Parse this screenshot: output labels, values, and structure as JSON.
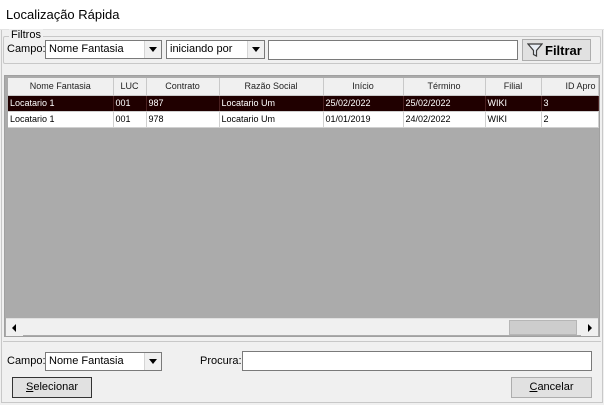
{
  "window": {
    "title": "Localização Rápida"
  },
  "filters": {
    "legend": "Filtros",
    "field_label": "Campo:",
    "field_value": "Nome Fantasia",
    "mode_value": "iniciando por",
    "search_value": "",
    "filter_button": "Filtrar"
  },
  "grid": {
    "columns": [
      "Nome Fantasia",
      "LUC",
      "Contrato",
      "Razão Social",
      "Início",
      "Término",
      "Filial",
      "ID Apro"
    ],
    "rows": [
      {
        "selected": true,
        "cells": [
          "Locatario 1",
          "001",
          "987",
          "Locatario Um",
          "25/02/2022",
          "25/02/2022",
          "WIKI",
          "3"
        ]
      },
      {
        "selected": false,
        "cells": [
          "Locatario 1",
          "001",
          "978",
          "Locatario Um",
          "01/01/2019",
          "24/02/2022",
          "WIKI",
          "2"
        ]
      }
    ]
  },
  "bottom": {
    "field_label": "Campo:",
    "field_value": "Nome Fantasia",
    "search_label": "Procura:",
    "search_value": "",
    "select_button": "Selecionar",
    "select_hotkey": "S",
    "select_rest": "elecionar",
    "cancel_button": "Cancelar",
    "cancel_hotkey": "C",
    "cancel_rest": "ancelar"
  },
  "colors": {
    "selected_row_bg": "#200000",
    "grid_bg": "#ababab",
    "window_bg": "#f0f0f0"
  },
  "icons": {
    "filter": "funnel-icon",
    "dropdown": "chevron-down-icon",
    "scroll_left": "arrow-left-icon",
    "scroll_right": "arrow-right-icon"
  }
}
